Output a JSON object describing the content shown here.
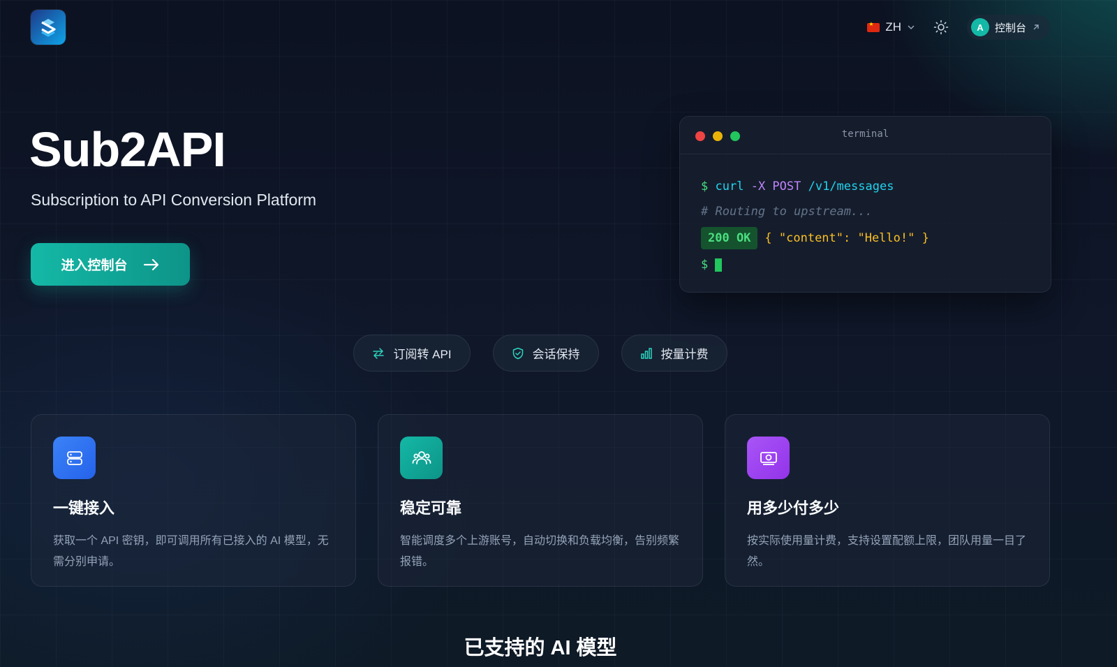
{
  "header": {
    "logo": "sub2api-logo",
    "language": "ZH",
    "console_label": "控制台",
    "avatar_initial": "A"
  },
  "hero": {
    "title": "Sub2API",
    "subtitle": "Subscription to API Conversion Platform",
    "cta_label": "进入控制台"
  },
  "terminal": {
    "title": "terminal",
    "prompt": "$",
    "cmd_curl": "curl",
    "cmd_flag": "-X POST",
    "cmd_path": "/v1/messages",
    "comment": "# Routing to upstream...",
    "status": "200 OK",
    "response": "{ \"content\": \"Hello!\" }"
  },
  "pills": [
    {
      "label": "订阅转 API",
      "icon": "swap-arrows-icon"
    },
    {
      "label": "会话保持",
      "icon": "shield-check-icon"
    },
    {
      "label": "按量计费",
      "icon": "bar-chart-icon"
    }
  ],
  "features": [
    {
      "title": "一键接入",
      "desc": "获取一个 API 密钥，即可调用所有已接入的 AI 模型，无需分别申请。",
      "icon": "server-icon",
      "color": "#3b82f6"
    },
    {
      "title": "稳定可靠",
      "desc": "智能调度多个上游账号，自动切换和负载均衡，告别频繁报错。",
      "icon": "users-icon",
      "color": "#14b8a6"
    },
    {
      "title": "用多少付多少",
      "desc": "按实际使用量计费，支持设置配额上限，团队用量一目了然。",
      "icon": "money-icon",
      "color": "#a855f7"
    }
  ],
  "models_section_title": "已支持的 AI 模型",
  "colors": {
    "accent": "#14b8a6",
    "background": "#0f1729",
    "terminal_green": "#4ade80",
    "terminal_purple": "#c084fc",
    "terminal_cyan": "#22d3ee",
    "terminal_yellow": "#fbbf24"
  }
}
